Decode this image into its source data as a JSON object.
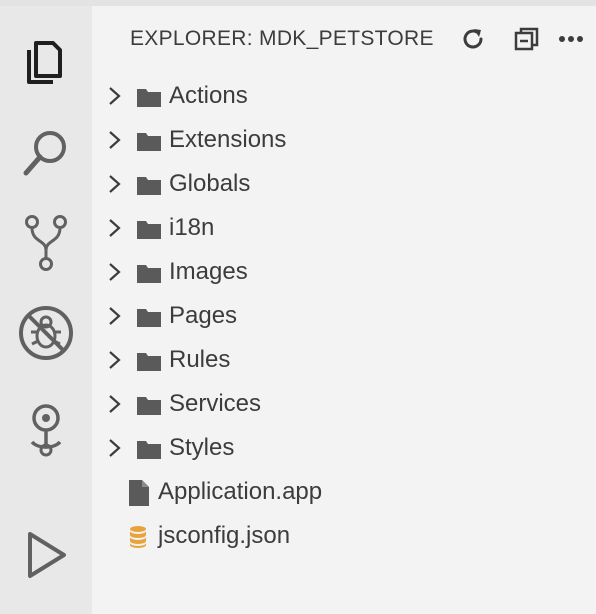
{
  "activity_bar": {
    "items": [
      {
        "name": "explorer-icon"
      },
      {
        "name": "search-icon"
      },
      {
        "name": "source-control-icon"
      },
      {
        "name": "debug-disabled-icon"
      },
      {
        "name": "mdk-icon"
      },
      {
        "name": "run-icon"
      }
    ]
  },
  "explorer": {
    "title": "EXPLORER: MDK_PETSTORE",
    "actions": [
      {
        "name": "refresh-icon"
      },
      {
        "name": "collapse-all-icon"
      },
      {
        "name": "more-actions-icon"
      }
    ],
    "folders": [
      "Actions",
      "Extensions",
      "Globals",
      "i18n",
      "Images",
      "Pages",
      "Rules",
      "Services",
      "Styles"
    ],
    "files": [
      {
        "label": "Application.app",
        "icon": "file-icon"
      },
      {
        "label": "jsconfig.json",
        "icon": "json-db-icon",
        "icon_color": "#e8a33c"
      }
    ]
  },
  "colors": {
    "activity_bg": "#e8e8e8",
    "sidebar_bg": "#f3f3f3",
    "icon_gray": "#616161",
    "folder_gray": "#5a5a5a",
    "text": "#3c3c3c"
  }
}
